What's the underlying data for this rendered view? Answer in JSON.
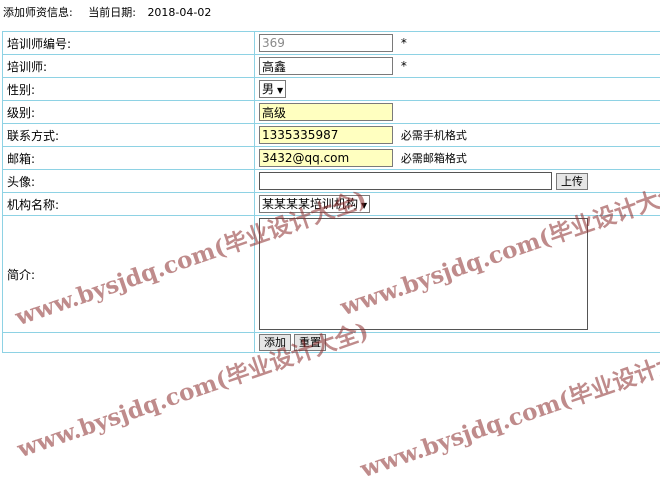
{
  "header": {
    "title": "添加师资信息:",
    "date_label": "当前日期:",
    "date_value": "2018-04-02"
  },
  "form": {
    "id": {
      "label": "培训师编号:",
      "value": "369",
      "required_mark": "*"
    },
    "name": {
      "label": "培训师:",
      "value": "高鑫",
      "required_mark": "*"
    },
    "gender": {
      "label": "性别:",
      "selected": "男"
    },
    "level": {
      "label": "级别:",
      "value": "高级"
    },
    "phone": {
      "label": "联系方式:",
      "value": "1335335987",
      "hint": "必需手机格式"
    },
    "email": {
      "label": "邮箱:",
      "value": "3432@qq.com",
      "hint": "必需邮箱格式"
    },
    "avatar": {
      "label": "头像:",
      "upload_label": "上传"
    },
    "org": {
      "label": "机构名称:",
      "selected": "某某某某培训机构"
    },
    "intro": {
      "label": "简介:"
    },
    "actions": {
      "add_label": "添加",
      "reset_label": "重置"
    }
  },
  "watermark": "www.bysjdq.com(毕业设计大全)",
  "colors": {
    "border": "#8ed2e4",
    "input_highlight": "#ffffc0",
    "watermark": "#8c2d2d"
  },
  "icons": {
    "dropdown": "triangle-down"
  }
}
